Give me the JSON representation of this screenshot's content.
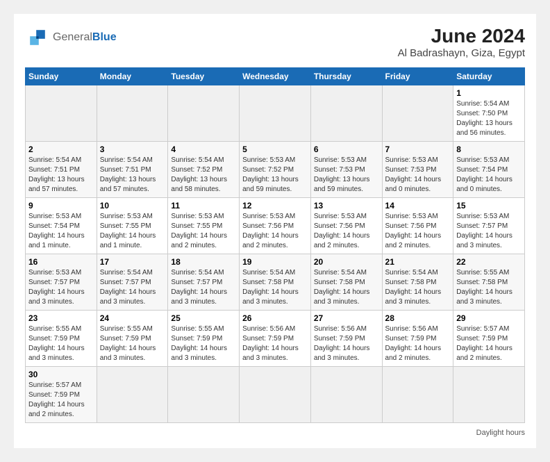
{
  "header": {
    "logo_general": "General",
    "logo_blue": "Blue",
    "title": "June 2024",
    "subtitle": "Al Badrashayn, Giza, Egypt"
  },
  "days_of_week": [
    "Sunday",
    "Monday",
    "Tuesday",
    "Wednesday",
    "Thursday",
    "Friday",
    "Saturday"
  ],
  "weeks": [
    [
      {
        "day": "",
        "info": ""
      },
      {
        "day": "",
        "info": ""
      },
      {
        "day": "",
        "info": ""
      },
      {
        "day": "",
        "info": ""
      },
      {
        "day": "",
        "info": ""
      },
      {
        "day": "",
        "info": ""
      },
      {
        "day": "1",
        "info": "Sunrise: 5:54 AM\nSunset: 7:50 PM\nDaylight: 13 hours\nand 56 minutes."
      }
    ],
    [
      {
        "day": "2",
        "info": "Sunrise: 5:54 AM\nSunset: 7:51 PM\nDaylight: 13 hours\nand 57 minutes."
      },
      {
        "day": "3",
        "info": "Sunrise: 5:54 AM\nSunset: 7:51 PM\nDaylight: 13 hours\nand 57 minutes."
      },
      {
        "day": "4",
        "info": "Sunrise: 5:54 AM\nSunset: 7:52 PM\nDaylight: 13 hours\nand 58 minutes."
      },
      {
        "day": "5",
        "info": "Sunrise: 5:53 AM\nSunset: 7:52 PM\nDaylight: 13 hours\nand 59 minutes."
      },
      {
        "day": "6",
        "info": "Sunrise: 5:53 AM\nSunset: 7:53 PM\nDaylight: 13 hours\nand 59 minutes."
      },
      {
        "day": "7",
        "info": "Sunrise: 5:53 AM\nSunset: 7:53 PM\nDaylight: 14 hours\nand 0 minutes."
      },
      {
        "day": "8",
        "info": "Sunrise: 5:53 AM\nSunset: 7:54 PM\nDaylight: 14 hours\nand 0 minutes."
      }
    ],
    [
      {
        "day": "9",
        "info": "Sunrise: 5:53 AM\nSunset: 7:54 PM\nDaylight: 14 hours\nand 1 minute."
      },
      {
        "day": "10",
        "info": "Sunrise: 5:53 AM\nSunset: 7:55 PM\nDaylight: 14 hours\nand 1 minute."
      },
      {
        "day": "11",
        "info": "Sunrise: 5:53 AM\nSunset: 7:55 PM\nDaylight: 14 hours\nand 2 minutes."
      },
      {
        "day": "12",
        "info": "Sunrise: 5:53 AM\nSunset: 7:56 PM\nDaylight: 14 hours\nand 2 minutes."
      },
      {
        "day": "13",
        "info": "Sunrise: 5:53 AM\nSunset: 7:56 PM\nDaylight: 14 hours\nand 2 minutes."
      },
      {
        "day": "14",
        "info": "Sunrise: 5:53 AM\nSunset: 7:56 PM\nDaylight: 14 hours\nand 2 minutes."
      },
      {
        "day": "15",
        "info": "Sunrise: 5:53 AM\nSunset: 7:57 PM\nDaylight: 14 hours\nand 3 minutes."
      }
    ],
    [
      {
        "day": "16",
        "info": "Sunrise: 5:53 AM\nSunset: 7:57 PM\nDaylight: 14 hours\nand 3 minutes."
      },
      {
        "day": "17",
        "info": "Sunrise: 5:54 AM\nSunset: 7:57 PM\nDaylight: 14 hours\nand 3 minutes."
      },
      {
        "day": "18",
        "info": "Sunrise: 5:54 AM\nSunset: 7:57 PM\nDaylight: 14 hours\nand 3 minutes."
      },
      {
        "day": "19",
        "info": "Sunrise: 5:54 AM\nSunset: 7:58 PM\nDaylight: 14 hours\nand 3 minutes."
      },
      {
        "day": "20",
        "info": "Sunrise: 5:54 AM\nSunset: 7:58 PM\nDaylight: 14 hours\nand 3 minutes."
      },
      {
        "day": "21",
        "info": "Sunrise: 5:54 AM\nSunset: 7:58 PM\nDaylight: 14 hours\nand 3 minutes."
      },
      {
        "day": "22",
        "info": "Sunrise: 5:55 AM\nSunset: 7:58 PM\nDaylight: 14 hours\nand 3 minutes."
      }
    ],
    [
      {
        "day": "23",
        "info": "Sunrise: 5:55 AM\nSunset: 7:59 PM\nDaylight: 14 hours\nand 3 minutes."
      },
      {
        "day": "24",
        "info": "Sunrise: 5:55 AM\nSunset: 7:59 PM\nDaylight: 14 hours\nand 3 minutes."
      },
      {
        "day": "25",
        "info": "Sunrise: 5:55 AM\nSunset: 7:59 PM\nDaylight: 14 hours\nand 3 minutes."
      },
      {
        "day": "26",
        "info": "Sunrise: 5:56 AM\nSunset: 7:59 PM\nDaylight: 14 hours\nand 3 minutes."
      },
      {
        "day": "27",
        "info": "Sunrise: 5:56 AM\nSunset: 7:59 PM\nDaylight: 14 hours\nand 3 minutes."
      },
      {
        "day": "28",
        "info": "Sunrise: 5:56 AM\nSunset: 7:59 PM\nDaylight: 14 hours\nand 2 minutes."
      },
      {
        "day": "29",
        "info": "Sunrise: 5:57 AM\nSunset: 7:59 PM\nDaylight: 14 hours\nand 2 minutes."
      }
    ],
    [
      {
        "day": "30",
        "info": "Sunrise: 5:57 AM\nSunset: 7:59 PM\nDaylight: 14 hours\nand 2 minutes."
      },
      {
        "day": "",
        "info": ""
      },
      {
        "day": "",
        "info": ""
      },
      {
        "day": "",
        "info": ""
      },
      {
        "day": "",
        "info": ""
      },
      {
        "day": "",
        "info": ""
      },
      {
        "day": "",
        "info": ""
      }
    ]
  ],
  "footer": {
    "note": "Daylight hours"
  }
}
